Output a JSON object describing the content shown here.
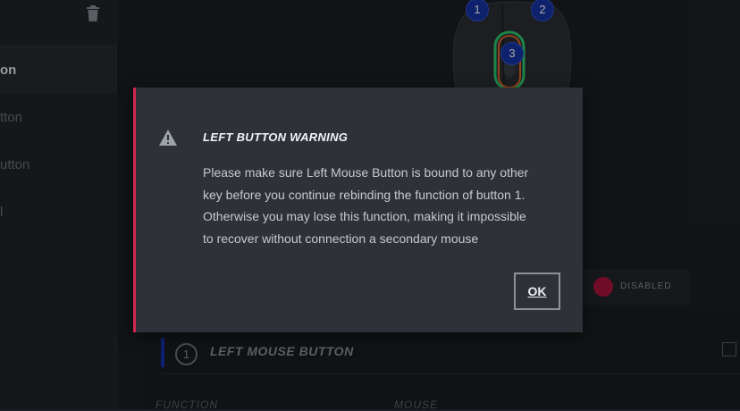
{
  "sidebar": {
    "items": [
      {
        "label": "on",
        "active": true
      },
      {
        "label": "tton",
        "active": false
      },
      {
        "label": "utton",
        "active": false
      },
      {
        "label": "l",
        "active": false
      }
    ]
  },
  "mouse_markers": [
    "1",
    "2",
    "3"
  ],
  "toggle": {
    "label": "DISABLED",
    "color": "#b0153d"
  },
  "button_row": {
    "number": "1",
    "title": "LEFT MOUSE BUTTON"
  },
  "columns": [
    "FUNCTION",
    "MOUSE"
  ],
  "dialog": {
    "title": "LEFT BUTTON WARNING",
    "lines": [
      "Please make sure Left Mouse Button is bound to any other",
      "key before you continue rebinding the function of button 1.",
      "Otherwise you may lose this function, making it impossible",
      "to recover without connection a secondary mouse"
    ],
    "ok_label": "OK",
    "accent_color": "#d3274f"
  }
}
